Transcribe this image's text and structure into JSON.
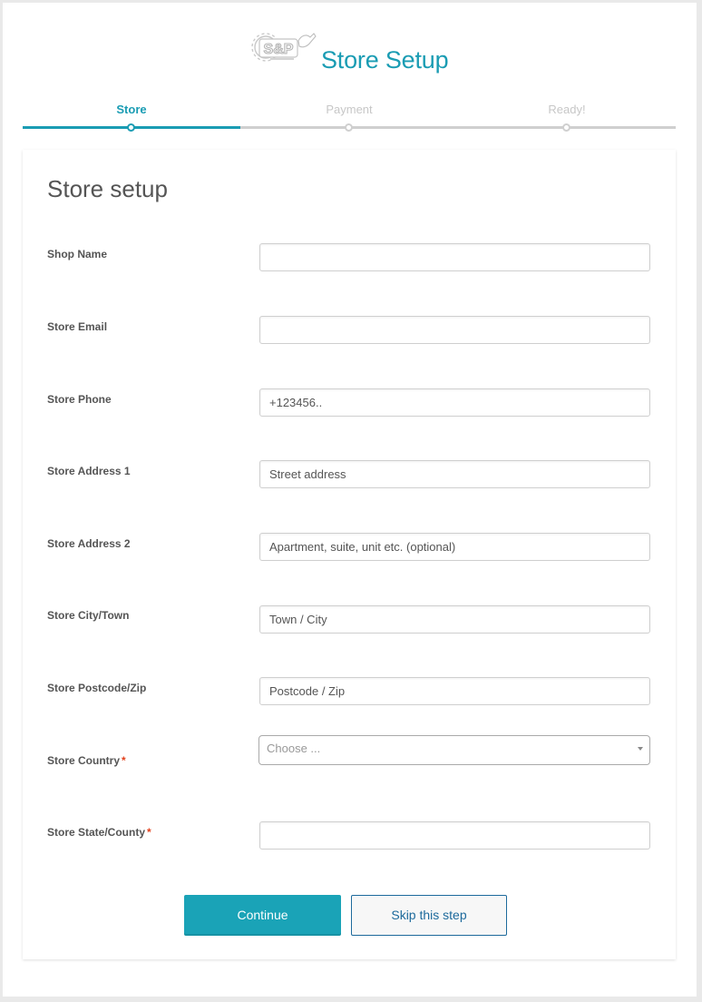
{
  "header": {
    "logo_text": "S&P",
    "title": "Store Setup"
  },
  "steps": [
    {
      "label": "Store",
      "active": true
    },
    {
      "label": "Payment",
      "active": false
    },
    {
      "label": "Ready!",
      "active": false
    }
  ],
  "form": {
    "title": "Store setup",
    "fields": {
      "shop_name": {
        "label": "Shop Name",
        "value": "",
        "placeholder": ""
      },
      "store_email": {
        "label": "Store Email",
        "value": "",
        "placeholder": ""
      },
      "store_phone": {
        "label": "Store Phone",
        "value": "",
        "placeholder": "+123456.."
      },
      "address1": {
        "label": "Store Address 1",
        "value": "",
        "placeholder": "Street address"
      },
      "address2": {
        "label": "Store Address 2",
        "value": "",
        "placeholder": "Apartment, suite, unit etc. (optional)"
      },
      "city": {
        "label": "Store City/Town",
        "value": "",
        "placeholder": "Town / City"
      },
      "postcode": {
        "label": "Store Postcode/Zip",
        "value": "",
        "placeholder": "Postcode / Zip"
      },
      "country": {
        "label": "Store Country",
        "required_mark": "*",
        "selected": "Choose ..."
      },
      "state": {
        "label": "Store State/County",
        "required_mark": "*",
        "value": "",
        "placeholder": ""
      }
    }
  },
  "actions": {
    "continue_label": "Continue",
    "skip_label": "Skip this step"
  },
  "colors": {
    "accent": "#1a9cb3",
    "button_primary": "#1aa3b7",
    "required": "#e2401c",
    "link": "#1d6a9c"
  }
}
